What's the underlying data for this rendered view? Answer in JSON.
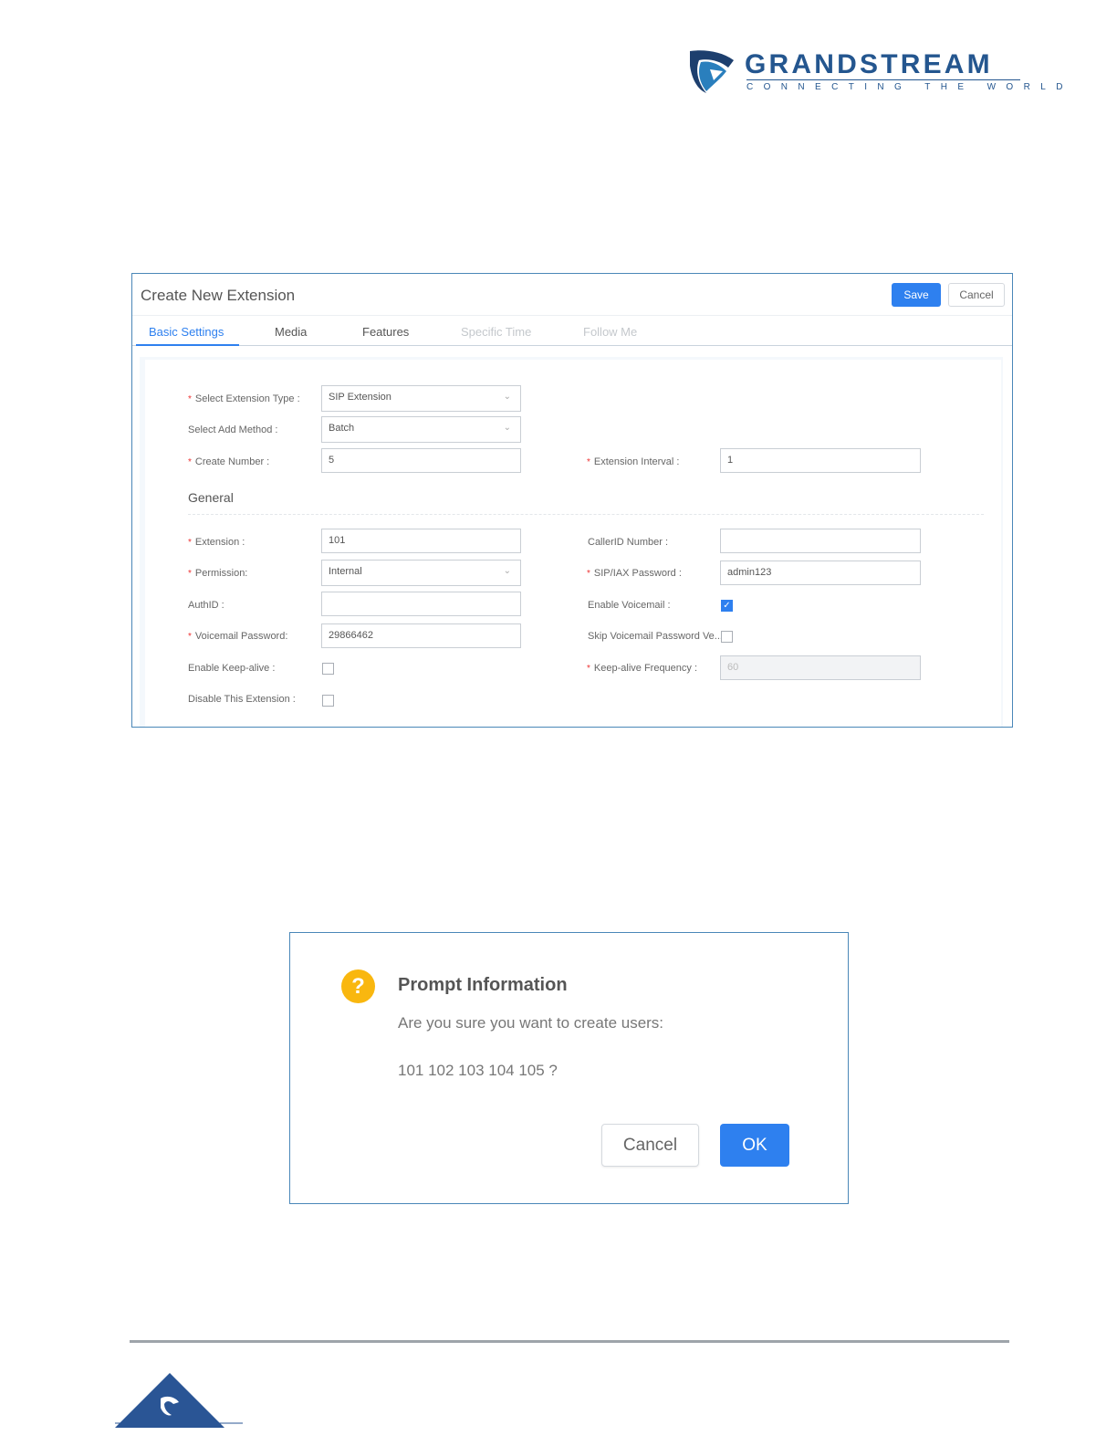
{
  "brand": {
    "name": "GRANDSTREAM",
    "tagline": "CONNECTING THE WORLD",
    "color": "#24568f"
  },
  "extension_dialog": {
    "title": "Create New Extension",
    "save_label": "Save",
    "cancel_label": "Cancel",
    "tabs": [
      {
        "label": "Basic Settings",
        "state": "active"
      },
      {
        "label": "Media",
        "state": "normal"
      },
      {
        "label": "Features",
        "state": "normal"
      },
      {
        "label": "Specific Time",
        "state": "disabled"
      },
      {
        "label": "Follow Me",
        "state": "disabled"
      }
    ],
    "fields": {
      "extension_type": {
        "label": "Select Extension Type :",
        "value": "SIP Extension"
      },
      "add_method": {
        "label": "Select Add Method :",
        "value": "Batch"
      },
      "create_number": {
        "label": "Create Number :",
        "value": "5"
      },
      "extension_interval": {
        "label": "Extension Interval :",
        "value": "1"
      },
      "general_title": "General",
      "extension": {
        "label": "Extension :",
        "value": "101"
      },
      "callerid_number": {
        "label": "CallerID Number :",
        "value": ""
      },
      "permission": {
        "label": "Permission:",
        "value": "Internal"
      },
      "sip_password": {
        "label": "SIP/IAX Password :",
        "value": "admin123"
      },
      "authid": {
        "label": "AuthID :",
        "value": ""
      },
      "enable_voicemail": {
        "label": "Enable Voicemail :",
        "checked": true
      },
      "voicemail_password": {
        "label": "Voicemail Password:",
        "value": "29866462"
      },
      "skip_voicemail_password": {
        "label": "Skip Voicemail Password Ve...",
        "checked": false
      },
      "enable_keepalive": {
        "label": "Enable Keep-alive :",
        "checked": false
      },
      "keepalive_frequency": {
        "label": "Keep-alive Frequency :",
        "value": "60"
      },
      "disable_extension": {
        "label": "Disable This Extension :",
        "checked": false
      }
    }
  },
  "prompt_dialog": {
    "icon": "question-icon",
    "title": "Prompt Information",
    "message": "Are you sure you want to create users:",
    "users": "101 102 103 104 105 ?",
    "cancel_label": "Cancel",
    "ok_label": "OK"
  },
  "colors": {
    "accent": "#2e80ef",
    "required": "#e33333",
    "warning": "#f9b70f"
  }
}
